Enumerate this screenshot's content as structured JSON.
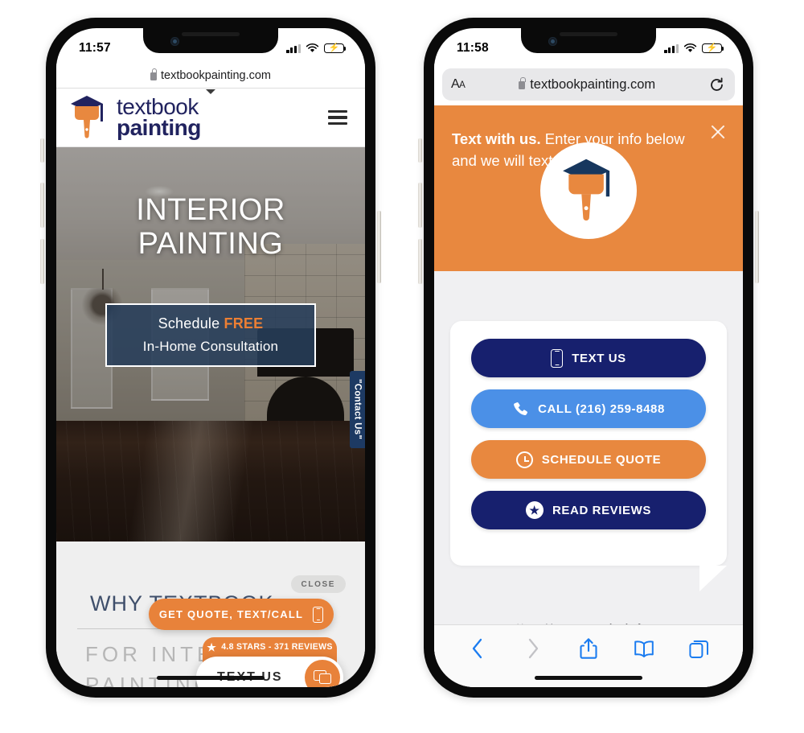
{
  "phone1": {
    "status": {
      "time": "11:57",
      "signal_icon": "cellular-signal-icon",
      "wifi_icon": "wifi-icon",
      "battery_icon": "battery-charging-icon"
    },
    "browser": {
      "url": "textbookpainting.com",
      "lock_icon": "lock-icon",
      "chevron_icon": "chevron-down-icon"
    },
    "site_header": {
      "logo_icon": "textbook-painting-logo-icon",
      "wordmark_line1": "textbook",
      "wordmark_line2": "painting",
      "menu_icon": "hamburger-menu-icon"
    },
    "hero": {
      "title_line1": "INTERIOR",
      "title_line2": "PAINTING",
      "cta_line1_prefix": "Schedule ",
      "cta_line1_emphasis": "FREE",
      "cta_line2": "In-Home Consultation",
      "side_tab": "\"Contact Us\""
    },
    "content": {
      "heading": "WHY TEXTBOOK",
      "sub_line1": "FOR INTERIOR",
      "sub_line2": "PAINTING?"
    },
    "widget": {
      "close_label": "CLOSE",
      "get_quote_label": "GET QUOTE, TEXT/CALL",
      "get_quote_icon": "mobile-phone-icon",
      "reviews_label": "4.8 STARS - 371 REVIEWS",
      "star_icon": "star-icon",
      "text_us_label": "TEXT US",
      "chat_icon": "chat-bubbles-icon"
    }
  },
  "phone2": {
    "status": {
      "time": "11:58",
      "signal_icon": "cellular-signal-icon",
      "wifi_icon": "wifi-icon",
      "battery_icon": "battery-charging-icon"
    },
    "browser": {
      "text_size_label": "AA",
      "url": "textbookpainting.com",
      "lock_icon": "lock-icon",
      "reload_icon": "reload-icon"
    },
    "panel": {
      "headline_bold": "Text with us.",
      "headline_rest": " Enter your info below and we will text you back.",
      "close_icon": "close-x-icon",
      "avatar_icon": "textbook-painting-logo-icon"
    },
    "actions": [
      {
        "label": "TEXT US",
        "icon": "mobile-phone-icon",
        "style": "lf-navy",
        "name": "text-us-button"
      },
      {
        "label": "CALL (216) 259-8488",
        "icon": "phone-handset-icon",
        "style": "lf-blue",
        "name": "call-button"
      },
      {
        "label": "SCHEDULE QUOTE",
        "icon": "clock-icon",
        "style": "lf-orange",
        "name": "schedule-quote-button"
      },
      {
        "label": "READ REVIEWS",
        "icon": "star-circle-icon",
        "style": "lf-navy",
        "name": "read-reviews-button"
      }
    ],
    "footer": {
      "terms": "Use subject to terms • ",
      "brand_pre": "lead",
      "brand_flame": "🔥",
      "brand_post": "ferno"
    },
    "toolbar": [
      {
        "name": "back-button",
        "icon": "chevron-left-icon"
      },
      {
        "name": "forward-button",
        "icon": "chevron-right-icon"
      },
      {
        "name": "share-button",
        "icon": "share-icon"
      },
      {
        "name": "bookmarks-button",
        "icon": "book-icon"
      },
      {
        "name": "tabs-button",
        "icon": "tabs-icon"
      }
    ]
  },
  "colors": {
    "brand_orange": "#e8883f",
    "brand_navy": "#17206e",
    "accent_blue": "#4b90e7",
    "hero_overlay_navy": "#273e5a",
    "logo_navy": "#21235f"
  }
}
